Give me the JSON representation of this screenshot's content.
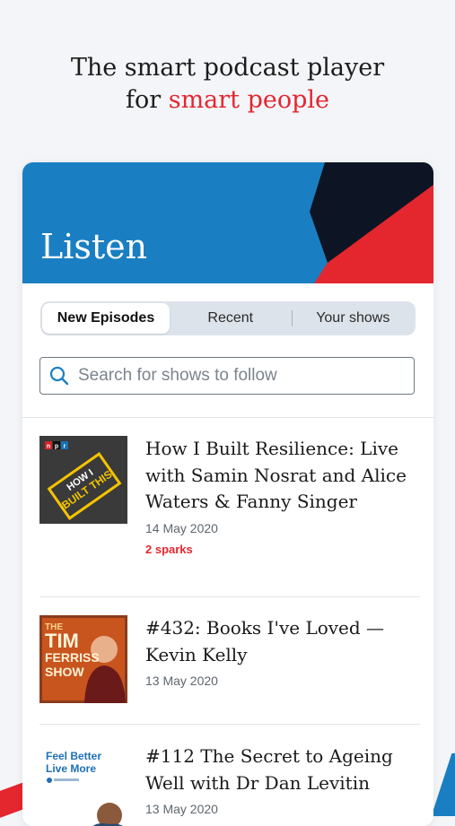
{
  "tagline": {
    "line1": "The smart podcast player",
    "line2_prefix": "for ",
    "line2_accent": "smart people"
  },
  "header": {
    "title": "Listen"
  },
  "tabs": [
    {
      "label": "New Episodes",
      "active": true
    },
    {
      "label": "Recent",
      "active": false
    },
    {
      "label": "Your shows",
      "active": false
    }
  ],
  "search": {
    "placeholder": "Search for shows to follow",
    "icon": "search-icon"
  },
  "episodes": [
    {
      "title": "How I Built Resilience: Live with Samin Nosrat and Alice Waters & Fanny Singer",
      "date": "14 May 2020",
      "sparks": "2 sparks",
      "art": {
        "badge": "npr",
        "text_lines": [
          "HOW",
          "I",
          "BUILT",
          "THIS"
        ]
      }
    },
    {
      "title": "#432: Books I've Loved — Kevin Kelly",
      "date": "13 May 2020",
      "art": {
        "text_lines": [
          "THE",
          "TIM",
          "FERRISS",
          "SHOW"
        ]
      }
    },
    {
      "title": "#112 The Secret to Ageing Well with Dr Dan Levitin",
      "date": "13 May 2020",
      "art": {
        "text_lines": [
          "Feel Better",
          "Live More"
        ]
      }
    }
  ],
  "colors": {
    "accent_red": "#e4262f",
    "banner_blue": "#1a7fc2",
    "banner_dark": "#0d1524"
  }
}
